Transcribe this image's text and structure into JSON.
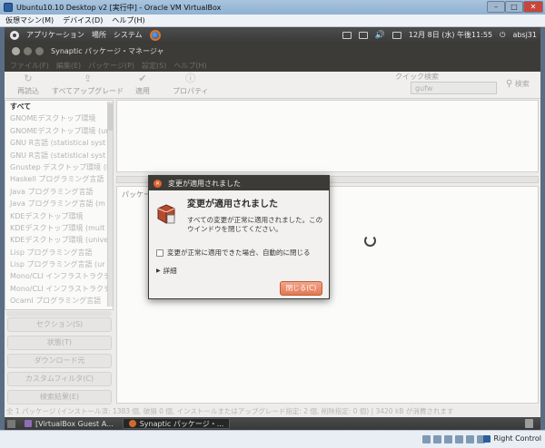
{
  "vbox": {
    "title": "Ubuntu10.10 Desktop v2 [実行中] - Oracle VM VirtualBox",
    "menu": [
      "仮想マシン(M)",
      "デバイス(D)",
      "ヘルプ(H)"
    ],
    "min": "–",
    "max": "□",
    "close": "✕",
    "host_key": "Right Control"
  },
  "panel": {
    "menu": [
      "アプリケーション",
      "場所",
      "システム"
    ],
    "clock": "12月 8日 (水) 午後11:55",
    "user": "absj31"
  },
  "synaptic": {
    "title": "Synaptic パッケージ・マネージャ",
    "menu": [
      "ファイル(F)",
      "編集(E)",
      "パッケージ(P)",
      "設定(S)",
      "ヘルプ(H)"
    ],
    "toolbar": {
      "reload": "再読込",
      "upgrade_all": "すべてアップグレード",
      "apply": "適用",
      "properties": "プロパティ"
    },
    "quick_search_label": "クイック検索",
    "quick_search_value": "gufw",
    "search": "検索",
    "sidebar": [
      "すべて",
      "GNOMEデスクトップ環境",
      "GNOMEデスクトップ環境 (ur",
      "GNU R言語 (statistical syst",
      "GNU R言語 (statistical syst",
      "Gnustep デスクトップ環境 (i",
      "Haskell プログラミング言語",
      "Java プログラミング言語",
      "Java プログラミング言語 (m",
      "KDEデスクトップ環境",
      "KDEデスクトップ環境 (mult",
      "KDEデスクトップ環境 (unive",
      "Lisp プログラミング言語",
      "Lisp プログラミング言語 (ur",
      "Mono/CLI インフラストラクチ",
      "Mono/CLI インフラストラクチ",
      "Ocaml プログラミング言語"
    ],
    "filters": [
      "セクション(S)",
      "状態(T)",
      "ダウンロード元",
      "カスタムフィルタ(C)",
      "検索結果(E)"
    ],
    "desc_label": "パッケージ",
    "status": "全 1 パッケージ (インストール済: 1383 個, 破損 0 個, インストールまたはアップグレード指定: 2 個, 削除指定: 0 個) | 3420 kB が消費されます"
  },
  "taskbar": {
    "items": [
      "[VirtualBox Guest A...",
      "Synaptic パッケージ・..."
    ]
  },
  "dialog": {
    "title": "変更が適用されました",
    "heading": "変更が適用されました",
    "message": "すべての変更が正常に適用されました。このウインドウを閉じてください。",
    "checkbox_label": "変更が正常に適用できた場合、自動的に閉じる",
    "details": "詳細",
    "close_button": "閉じる(C)"
  },
  "colors": {
    "accent": "#e37854",
    "panel": "#3c3b37"
  }
}
